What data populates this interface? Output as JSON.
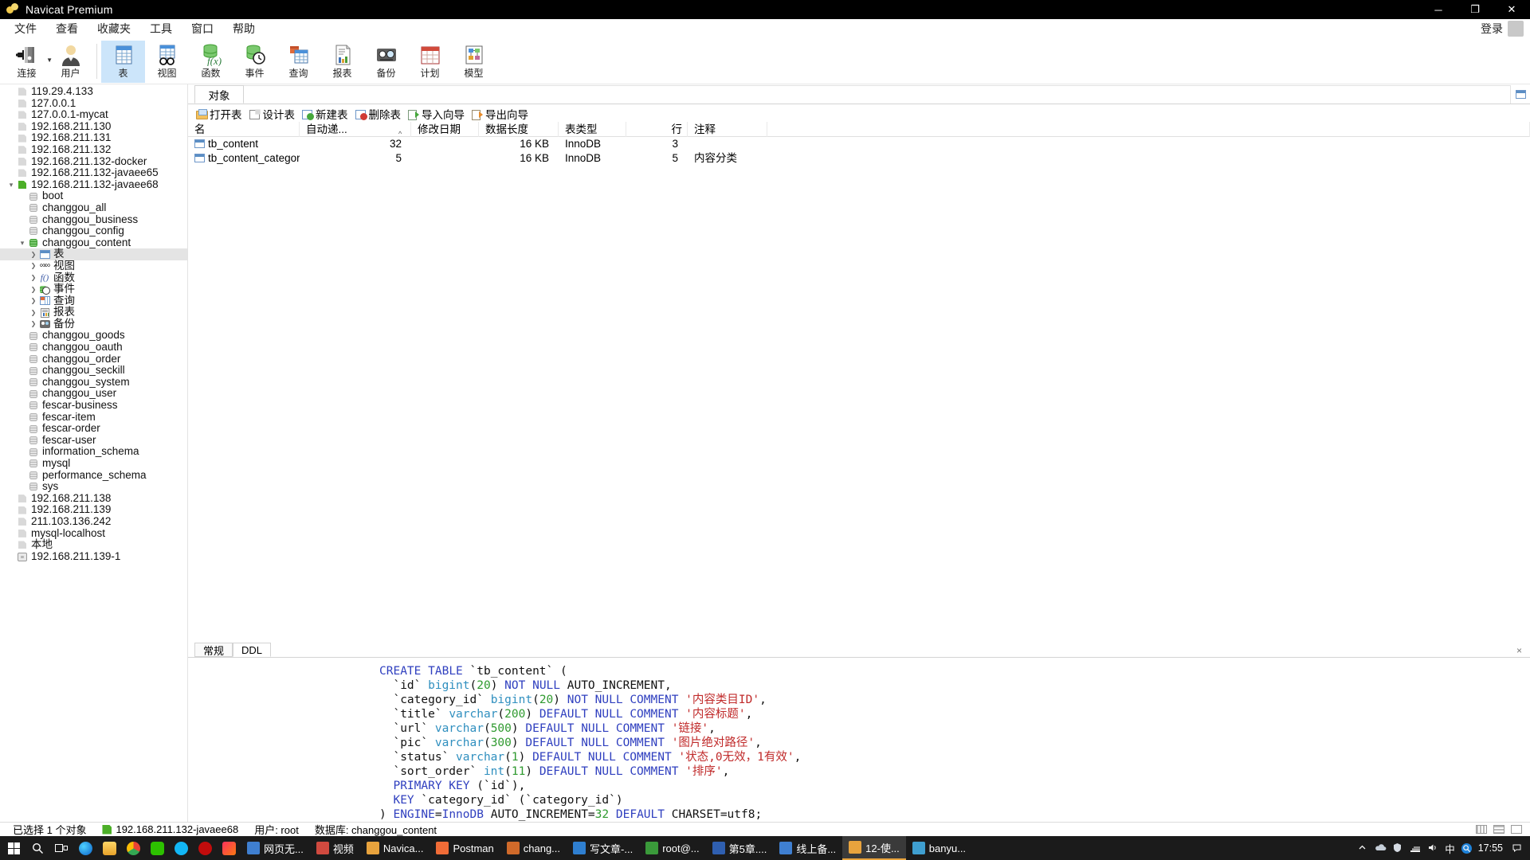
{
  "window": {
    "title": "Navicat Premium",
    "minimize": "─",
    "maximize": "❐",
    "close": "✕"
  },
  "menu": {
    "items": [
      "文件",
      "查看",
      "收藏夹",
      "工具",
      "窗口",
      "帮助"
    ],
    "login": "登录"
  },
  "toolbar": {
    "items": [
      {
        "label": "连接",
        "icon": "connection-icon",
        "selected": false,
        "caret": true
      },
      {
        "label": "用户",
        "icon": "user-icon",
        "selected": false,
        "caret": false
      },
      {
        "label": "表",
        "icon": "table-icon",
        "selected": true,
        "caret": false
      },
      {
        "label": "视图",
        "icon": "view-icon",
        "selected": false,
        "caret": false
      },
      {
        "label": "函数",
        "icon": "function-icon",
        "selected": false,
        "caret": false
      },
      {
        "label": "事件",
        "icon": "event-icon",
        "selected": false,
        "caret": false
      },
      {
        "label": "查询",
        "icon": "query-icon",
        "selected": false,
        "caret": false
      },
      {
        "label": "报表",
        "icon": "report-icon",
        "selected": false,
        "caret": false
      },
      {
        "label": "备份",
        "icon": "backup-icon",
        "selected": false,
        "caret": false
      },
      {
        "label": "计划",
        "icon": "schedule-icon",
        "selected": false,
        "caret": false
      },
      {
        "label": "模型",
        "icon": "model-icon",
        "selected": false,
        "caret": false
      }
    ]
  },
  "sidebar": {
    "nodes": [
      {
        "label": "119.29.4.133",
        "depth": 0,
        "icon": "connection",
        "arrow": "none",
        "selected": false
      },
      {
        "label": "127.0.0.1",
        "depth": 0,
        "icon": "connection",
        "arrow": "none",
        "selected": false
      },
      {
        "label": "127.0.0.1-mycat",
        "depth": 0,
        "icon": "connection",
        "arrow": "none",
        "selected": false
      },
      {
        "label": "192.168.211.130",
        "depth": 0,
        "icon": "connection",
        "arrow": "none",
        "selected": false
      },
      {
        "label": "192.168.211.131",
        "depth": 0,
        "icon": "connection",
        "arrow": "none",
        "selected": false
      },
      {
        "label": "192.168.211.132",
        "depth": 0,
        "icon": "connection",
        "arrow": "none",
        "selected": false
      },
      {
        "label": "192.168.211.132-docker",
        "depth": 0,
        "icon": "connection",
        "arrow": "none",
        "selected": false
      },
      {
        "label": "192.168.211.132-javaee65",
        "depth": 0,
        "icon": "connection",
        "arrow": "none",
        "selected": false
      },
      {
        "label": "192.168.211.132-javaee68",
        "depth": 0,
        "icon": "connection-active",
        "arrow": "open",
        "selected": false
      },
      {
        "label": "boot",
        "depth": 1,
        "icon": "db",
        "arrow": "none",
        "selected": false
      },
      {
        "label": "changgou_all",
        "depth": 1,
        "icon": "db",
        "arrow": "none",
        "selected": false
      },
      {
        "label": "changgou_business",
        "depth": 1,
        "icon": "db",
        "arrow": "none",
        "selected": false
      },
      {
        "label": "changgou_config",
        "depth": 1,
        "icon": "db",
        "arrow": "none",
        "selected": false
      },
      {
        "label": "changgou_content",
        "depth": 1,
        "icon": "db-open",
        "arrow": "open",
        "selected": false
      },
      {
        "label": "表",
        "depth": 2,
        "icon": "table",
        "arrow": "closed",
        "selected": true
      },
      {
        "label": "视图",
        "depth": 2,
        "icon": "view",
        "arrow": "closed",
        "selected": false
      },
      {
        "label": "函数",
        "depth": 2,
        "icon": "fx",
        "arrow": "closed",
        "selected": false
      },
      {
        "label": "事件",
        "depth": 2,
        "icon": "event",
        "arrow": "closed",
        "selected": false
      },
      {
        "label": "查询",
        "depth": 2,
        "icon": "query",
        "arrow": "closed",
        "selected": false
      },
      {
        "label": "报表",
        "depth": 2,
        "icon": "report",
        "arrow": "closed",
        "selected": false
      },
      {
        "label": "备份",
        "depth": 2,
        "icon": "backup",
        "arrow": "closed",
        "selected": false
      },
      {
        "label": "changgou_goods",
        "depth": 1,
        "icon": "db",
        "arrow": "none",
        "selected": false
      },
      {
        "label": "changgou_oauth",
        "depth": 1,
        "icon": "db",
        "arrow": "none",
        "selected": false
      },
      {
        "label": "changgou_order",
        "depth": 1,
        "icon": "db",
        "arrow": "none",
        "selected": false
      },
      {
        "label": "changgou_seckill",
        "depth": 1,
        "icon": "db",
        "arrow": "none",
        "selected": false
      },
      {
        "label": "changgou_system",
        "depth": 1,
        "icon": "db",
        "arrow": "none",
        "selected": false
      },
      {
        "label": "changgou_user",
        "depth": 1,
        "icon": "db",
        "arrow": "none",
        "selected": false
      },
      {
        "label": "fescar-business",
        "depth": 1,
        "icon": "db",
        "arrow": "none",
        "selected": false
      },
      {
        "label": "fescar-item",
        "depth": 1,
        "icon": "db",
        "arrow": "none",
        "selected": false
      },
      {
        "label": "fescar-order",
        "depth": 1,
        "icon": "db",
        "arrow": "none",
        "selected": false
      },
      {
        "label": "fescar-user",
        "depth": 1,
        "icon": "db",
        "arrow": "none",
        "selected": false
      },
      {
        "label": "information_schema",
        "depth": 1,
        "icon": "db",
        "arrow": "none",
        "selected": false
      },
      {
        "label": "mysql",
        "depth": 1,
        "icon": "db",
        "arrow": "none",
        "selected": false
      },
      {
        "label": "performance_schema",
        "depth": 1,
        "icon": "db",
        "arrow": "none",
        "selected": false
      },
      {
        "label": "sys",
        "depth": 1,
        "icon": "db",
        "arrow": "none",
        "selected": false
      },
      {
        "label": "192.168.211.138",
        "depth": 0,
        "icon": "connection",
        "arrow": "none",
        "selected": false
      },
      {
        "label": "192.168.211.139",
        "depth": 0,
        "icon": "connection",
        "arrow": "none",
        "selected": false
      },
      {
        "label": "211.103.136.242",
        "depth": 0,
        "icon": "connection",
        "arrow": "none",
        "selected": false
      },
      {
        "label": "mysql-localhost",
        "depth": 0,
        "icon": "connection",
        "arrow": "none",
        "selected": false
      },
      {
        "label": "本地",
        "depth": 0,
        "icon": "connection",
        "arrow": "none",
        "selected": false
      },
      {
        "label": "192.168.211.139-1",
        "depth": 0,
        "icon": "square",
        "arrow": "none",
        "selected": false
      }
    ]
  },
  "objectbar": {
    "tab_label": "对象",
    "right_icon": "table-icon"
  },
  "actions": [
    {
      "label": "打开表",
      "icon": "open-table-icon"
    },
    {
      "label": "设计表",
      "icon": "design-table-icon"
    },
    {
      "label": "新建表",
      "icon": "new-table-icon"
    },
    {
      "label": "删除表",
      "icon": "delete-table-icon"
    },
    {
      "label": "导入向导",
      "icon": "import-wizard-icon"
    },
    {
      "label": "导出向导",
      "icon": "export-wizard-icon"
    }
  ],
  "grid": {
    "columns": [
      "名",
      "自动递...",
      "修改日期",
      "数据长度",
      "表类型",
      "行",
      "注释"
    ],
    "rows": [
      {
        "name": "tb_content",
        "auto_inc": "32",
        "modified": "",
        "data_length": "16 KB",
        "engine": "InnoDB",
        "rows": "3",
        "comment": ""
      },
      {
        "name": "tb_content_category",
        "auto_inc": "5",
        "modified": "",
        "data_length": "16 KB",
        "engine": "InnoDB",
        "rows": "5",
        "comment": "内容分类"
      }
    ]
  },
  "detail": {
    "tabs": [
      {
        "label": "常规",
        "active": false
      },
      {
        "label": "DDL",
        "active": true
      }
    ],
    "close": "×",
    "ddl_lines": [
      [
        [
          "kw",
          "CREATE"
        ],
        [
          "bt",
          " "
        ],
        [
          "kw",
          "TABLE"
        ],
        [
          "bt",
          " `tb_content` ("
        ]
      ],
      [
        [
          "bt",
          "  `id` "
        ],
        [
          "ty",
          "bigint"
        ],
        [
          "bt",
          "("
        ],
        [
          "num2",
          "20"
        ],
        [
          "bt",
          ") "
        ],
        [
          "kw",
          "NOT NULL"
        ],
        [
          "bt",
          " AUTO_INCREMENT,"
        ]
      ],
      [
        [
          "bt",
          "  `category_id` "
        ],
        [
          "ty",
          "bigint"
        ],
        [
          "bt",
          "("
        ],
        [
          "num2",
          "20"
        ],
        [
          "bt",
          ") "
        ],
        [
          "kw",
          "NOT NULL"
        ],
        [
          "bt",
          " "
        ],
        [
          "kw",
          "COMMENT"
        ],
        [
          "bt",
          " "
        ],
        [
          "str",
          "'内容类目ID'"
        ],
        [
          "bt",
          ","
        ]
      ],
      [
        [
          "bt",
          "  `title` "
        ],
        [
          "ty",
          "varchar"
        ],
        [
          "bt",
          "("
        ],
        [
          "num2",
          "200"
        ],
        [
          "bt",
          ") "
        ],
        [
          "kw",
          "DEFAULT NULL"
        ],
        [
          "bt",
          " "
        ],
        [
          "kw",
          "COMMENT"
        ],
        [
          "bt",
          " "
        ],
        [
          "str",
          "'内容标题'"
        ],
        [
          "bt",
          ","
        ]
      ],
      [
        [
          "bt",
          "  `url` "
        ],
        [
          "ty",
          "varchar"
        ],
        [
          "bt",
          "("
        ],
        [
          "num2",
          "500"
        ],
        [
          "bt",
          ") "
        ],
        [
          "kw",
          "DEFAULT NULL"
        ],
        [
          "bt",
          " "
        ],
        [
          "kw",
          "COMMENT"
        ],
        [
          "bt",
          " "
        ],
        [
          "str",
          "'链接'"
        ],
        [
          "bt",
          ","
        ]
      ],
      [
        [
          "bt",
          "  `pic` "
        ],
        [
          "ty",
          "varchar"
        ],
        [
          "bt",
          "("
        ],
        [
          "num2",
          "300"
        ],
        [
          "bt",
          ") "
        ],
        [
          "kw",
          "DEFAULT NULL"
        ],
        [
          "bt",
          " "
        ],
        [
          "kw",
          "COMMENT"
        ],
        [
          "bt",
          " "
        ],
        [
          "str",
          "'图片绝对路径'"
        ],
        [
          "bt",
          ","
        ]
      ],
      [
        [
          "bt",
          "  `status` "
        ],
        [
          "ty",
          "varchar"
        ],
        [
          "bt",
          "("
        ],
        [
          "num2",
          "1"
        ],
        [
          "bt",
          ") "
        ],
        [
          "kw",
          "DEFAULT NULL"
        ],
        [
          "bt",
          " "
        ],
        [
          "kw",
          "COMMENT"
        ],
        [
          "bt",
          " "
        ],
        [
          "str",
          "'状态,0无效，1有效'"
        ],
        [
          "bt",
          ","
        ]
      ],
      [
        [
          "bt",
          "  `sort_order` "
        ],
        [
          "ty",
          "int"
        ],
        [
          "bt",
          "("
        ],
        [
          "num2",
          "11"
        ],
        [
          "bt",
          ") "
        ],
        [
          "kw",
          "DEFAULT NULL"
        ],
        [
          "bt",
          " "
        ],
        [
          "kw",
          "COMMENT"
        ],
        [
          "bt",
          " "
        ],
        [
          "str",
          "'排序'"
        ],
        [
          "bt",
          ","
        ]
      ],
      [
        [
          "bt",
          "  "
        ],
        [
          "kw",
          "PRIMARY KEY"
        ],
        [
          "bt",
          " (`id`),"
        ]
      ],
      [
        [
          "bt",
          "  "
        ],
        [
          "kw",
          "KEY"
        ],
        [
          "bt",
          " `category_id` (`category_id`)"
        ]
      ],
      [
        [
          "bt",
          ") "
        ],
        [
          "kw",
          "ENGINE"
        ],
        [
          "bt",
          "="
        ],
        [
          "kw",
          "InnoDB"
        ],
        [
          "bt",
          " AUTO_INCREMENT="
        ],
        [
          "num2",
          "32"
        ],
        [
          "bt",
          " "
        ],
        [
          "kw",
          "DEFAULT"
        ],
        [
          "bt",
          " CHARSET=utf8;"
        ]
      ]
    ]
  },
  "statusbar": {
    "selection": "已选择 1 个对象",
    "connection": "192.168.211.132-javaee68",
    "user": "用户: root",
    "database": "数据库: changgou_content"
  },
  "taskbar": {
    "start": "windows-start-icon",
    "pinned": [
      "search-icon",
      "taskview-icon",
      "edge-icon",
      "folder-icon",
      "chrome-icon",
      "wechat-icon",
      "qq-icon",
      "music-icon",
      "idea-icon"
    ],
    "tasks": [
      {
        "label": "网页无...",
        "active": false,
        "color": "#3f7fd0"
      },
      {
        "label": "视频",
        "active": false,
        "color": "#d04a3f"
      },
      {
        "label": "Navica...",
        "active": false,
        "color": "#e8a33d"
      },
      {
        "label": "Postman",
        "active": false,
        "color": "#f06c37"
      },
      {
        "label": "chang...",
        "active": false,
        "color": "#d06a2a"
      },
      {
        "label": "写文章-...",
        "active": false,
        "color": "#2f7fd0"
      },
      {
        "label": "root@...",
        "active": false,
        "color": "#3a9a3a"
      },
      {
        "label": "第5章....",
        "active": false,
        "color": "#2f5fb0"
      },
      {
        "label": "线上备...",
        "active": false,
        "color": "#3f7fd0"
      },
      {
        "label": "12-使...",
        "active": true,
        "color": "#e8a33d"
      },
      {
        "label": "banyu...",
        "active": false,
        "color": "#3f9fd0"
      }
    ],
    "tray_input": "中",
    "time": "17:55"
  }
}
